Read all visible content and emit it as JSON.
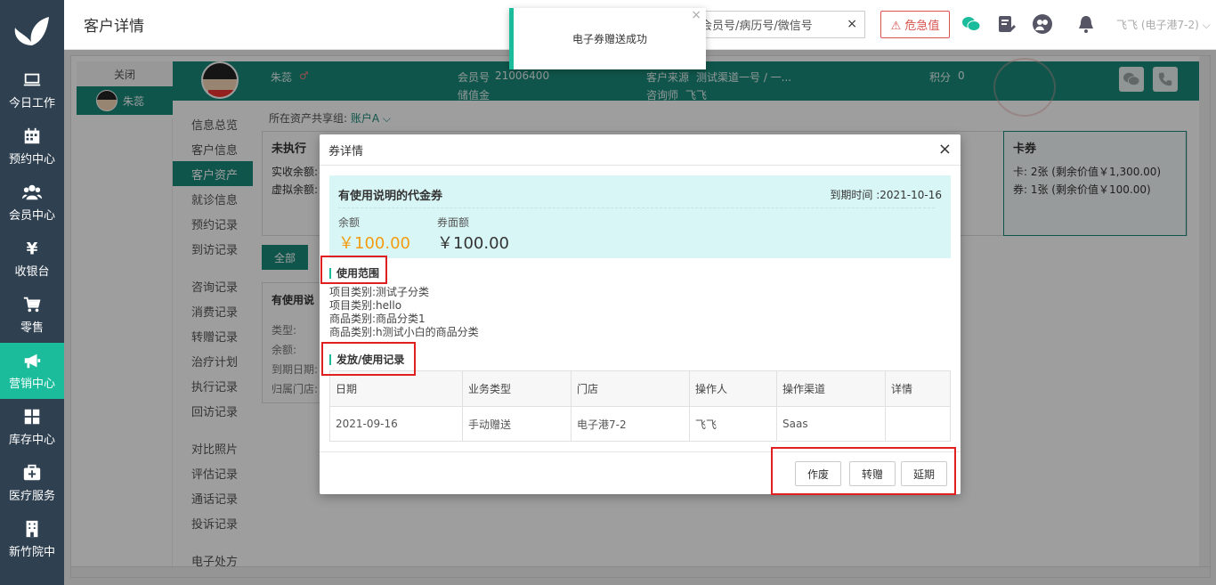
{
  "sidebar": {
    "items": [
      {
        "label": "今日工作",
        "icon": "laptop-icon"
      },
      {
        "label": "预约中心",
        "icon": "calendar-icon"
      },
      {
        "label": "会员中心",
        "icon": "users-icon"
      },
      {
        "label": "收银台",
        "icon": "yen-icon"
      },
      {
        "label": "零售",
        "icon": "cart-icon"
      },
      {
        "label": "营销中心",
        "icon": "megaphone-icon"
      },
      {
        "label": "库存中心",
        "icon": "grid-icon"
      },
      {
        "label": "医疗服务",
        "icon": "medkit-icon"
      },
      {
        "label": "新竹院中",
        "icon": "building-icon"
      }
    ]
  },
  "topbar": {
    "title": "客户详情",
    "search_text": "会员号/病历号/微信号",
    "search_clear": "×",
    "urgent_label": "⚠ 危急值",
    "user": "飞飞 (电子港7-2) ⌵"
  },
  "toast": {
    "message": "电子券赠送成功",
    "close": "×"
  },
  "tabs": {
    "close_label": "关闭",
    "customer_label": "朱蕊"
  },
  "header": {
    "name": "朱蕊",
    "gender_mark": "♂",
    "member_no_label": "会员号",
    "member_no": "21006400",
    "stored_value_label": "储值金",
    "source_label": "客户来源",
    "source": "测试渠道一号 / 一...",
    "consultant_label": "咨询师",
    "consultant": "飞飞",
    "points_label": "积分",
    "points": "0"
  },
  "submenu": {
    "items": [
      "信息总览",
      "客户信息",
      "客户资产",
      "就诊信息",
      "预约记录",
      "到访记录",
      "咨询记录",
      "消费记录",
      "转赠记录",
      "治疗计划",
      "执行记录",
      "回访记录",
      "对比照片",
      "评估记录",
      "通话记录",
      "投诉记录",
      "电子处方"
    ]
  },
  "main": {
    "share_label": "所在资产共享组:",
    "share_value": "账户A ⌵",
    "unexec_title": "未执行",
    "paid_label": "实收余额:",
    "virtual_label": "虚拟余额:",
    "cards_title": "卡券",
    "cards_line1": "卡:   2张 (剩余价值￥1,300.00)",
    "cards_line2": "券:   1张 (剩余价值￥100.00)",
    "all_btn": "全部",
    "coupon_card_title": "有使用说",
    "cc_type": "类型:",
    "cc_balance": "余额:",
    "cc_expire": "到期日期:",
    "cc_store": "归属门店:"
  },
  "modal": {
    "title": "券详情",
    "close": "×",
    "coupon_name": "有使用说明的代金券",
    "expire": "到期时间 :2021-10-16",
    "balance_label": "余额",
    "balance_value": "￥100.00",
    "face_label": "券面额",
    "face_value": "￥100.00",
    "scope_title": "使用范围",
    "scope_lines": [
      "项目类别:测试子分类",
      "项目类别:hello",
      "商品类别:商品分类1",
      "商品类别:h测试小白的商品分类"
    ],
    "record_title": "发放/使用记录",
    "table": {
      "headers": [
        "日期",
        "业务类型",
        "门店",
        "操作人",
        "操作渠道",
        "详情"
      ],
      "rows": [
        [
          "2021-09-16",
          "手动赠送",
          "电子港7-2",
          "飞飞",
          "Saas",
          ""
        ]
      ]
    },
    "buttons": {
      "void": "作废",
      "transfer": "转赠",
      "extend": "延期"
    }
  },
  "colors": {
    "sidebar": "#2f4050",
    "accent": "#1abc9c",
    "teal_band": "#1a8a7a",
    "price_orange": "#f39c12",
    "highlight": "#e02020"
  }
}
